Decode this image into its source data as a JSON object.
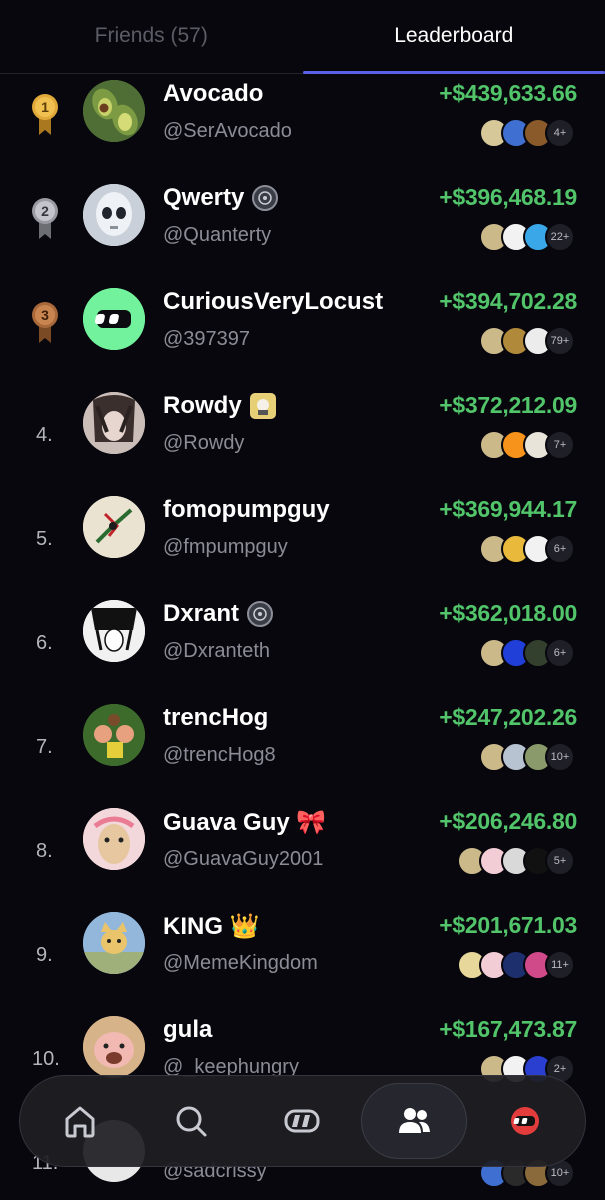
{
  "tabs": [
    {
      "label": "Friends (57)",
      "active": false
    },
    {
      "label": "Leaderboard",
      "active": true
    }
  ],
  "leaderboard": [
    {
      "rank": "1",
      "medal": "gold",
      "name": "Avocado",
      "handle": "@SerAvocado",
      "amount": "+$439,633.66",
      "more": "4+",
      "badge": ""
    },
    {
      "rank": "2",
      "medal": "silver",
      "name": "Qwerty",
      "handle": "@Quanterty",
      "amount": "+$396,468.19",
      "more": "22+",
      "badge": "seal"
    },
    {
      "rank": "3",
      "medal": "bronze",
      "name": "CuriousVeryLocust",
      "handle": "@397397",
      "amount": "+$394,702.28",
      "more": "79+",
      "badge": ""
    },
    {
      "rank": "4.",
      "medal": "",
      "name": "Rowdy",
      "handle": "@Rowdy",
      "amount": "+$372,212.09",
      "more": "7+",
      "badge": "pfp"
    },
    {
      "rank": "5.",
      "medal": "",
      "name": "fomopumpguy",
      "handle": "@fmpumpguy",
      "amount": "+$369,944.17",
      "more": "6+",
      "badge": ""
    },
    {
      "rank": "6.",
      "medal": "",
      "name": "Dxrant",
      "handle": "@Dxranteth",
      "amount": "+$362,018.00",
      "more": "6+",
      "badge": "seal"
    },
    {
      "rank": "7.",
      "medal": "",
      "name": "trencHog",
      "handle": "@trencHog8",
      "amount": "+$247,202.26",
      "more": "10+",
      "badge": ""
    },
    {
      "rank": "8.",
      "medal": "",
      "name": "Guava Guy 🎀",
      "handle": "@GuavaGuy2001",
      "amount": "+$206,246.80",
      "more": "5+",
      "badge": ""
    },
    {
      "rank": "9.",
      "medal": "",
      "name": "KING 👑",
      "handle": "@MemeKingdom",
      "amount": "+$201,671.03",
      "more": "11+",
      "badge": ""
    },
    {
      "rank": "10.",
      "medal": "",
      "name": "gula",
      "handle": "@_keephungry",
      "amount": "+$167,473.87",
      "more": "2+",
      "badge": ""
    },
    {
      "rank": "11.",
      "medal": "",
      "name": "",
      "handle": "@sadcrissy",
      "amount": "",
      "more": "10+",
      "badge": ""
    }
  ],
  "nav": {
    "items": [
      {
        "icon": "home-icon"
      },
      {
        "icon": "search-icon"
      },
      {
        "icon": "app-logo-icon"
      },
      {
        "icon": "friends-icon",
        "active": true
      },
      {
        "icon": "profile-icon"
      }
    ]
  },
  "colors": {
    "background": "#07070d",
    "accent": "#5861e8",
    "gain": "#52c46a",
    "muted": "#8c8c96"
  }
}
